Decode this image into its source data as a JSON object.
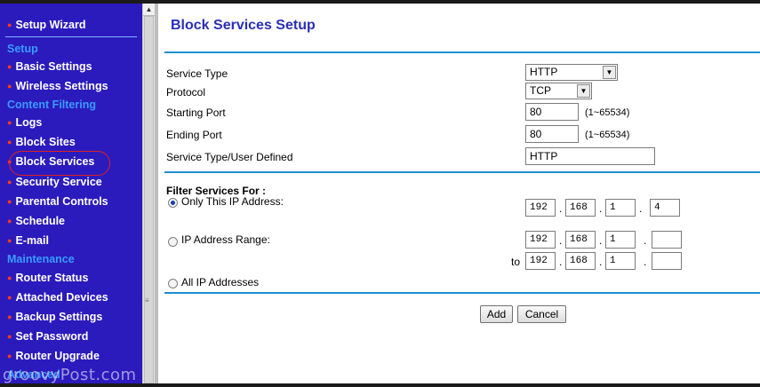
{
  "sidebar": {
    "items": [
      {
        "label": "Setup Wizard",
        "type": "item"
      },
      {
        "label": "Setup",
        "type": "header"
      },
      {
        "label": "Basic Settings",
        "type": "item"
      },
      {
        "label": "Wireless Settings",
        "type": "item"
      },
      {
        "label": "Content Filtering",
        "type": "header"
      },
      {
        "label": "Logs",
        "type": "item"
      },
      {
        "label": "Block Sites",
        "type": "item"
      },
      {
        "label": "Block Services",
        "type": "item",
        "highlighted": true
      },
      {
        "label": "Security Service",
        "type": "item"
      },
      {
        "label": "Parental Controls",
        "type": "item"
      },
      {
        "label": "Schedule",
        "type": "item"
      },
      {
        "label": "E-mail",
        "type": "item"
      },
      {
        "label": "Maintenance",
        "type": "header"
      },
      {
        "label": "Router Status",
        "type": "item"
      },
      {
        "label": "Attached Devices",
        "type": "item"
      },
      {
        "label": "Backup Settings",
        "type": "item"
      },
      {
        "label": "Set Password",
        "type": "item"
      },
      {
        "label": "Router Upgrade",
        "type": "item"
      },
      {
        "label": "Advanced",
        "type": "header"
      }
    ],
    "watermark": "groovyPost.com",
    "colors": {
      "background": "#2b1bbd",
      "header": "#3a9bff",
      "bullet": "#ff3b1a"
    }
  },
  "page": {
    "title": "Block Services Setup",
    "fields": {
      "service_type": {
        "label": "Service Type",
        "value": "HTTP"
      },
      "protocol": {
        "label": "Protocol",
        "value": "TCP"
      },
      "starting_port": {
        "label": "Starting Port",
        "value": "80",
        "range": "(1~65534)"
      },
      "ending_port": {
        "label": "Ending Port",
        "value": "80",
        "range": "(1~65534)"
      },
      "user_defined": {
        "label": "Service Type/User Defined",
        "value": "HTTP"
      }
    },
    "filter": {
      "heading": "Filter Services For :",
      "only_this_ip": {
        "label": "Only This IP Address:",
        "selected": true,
        "octets": [
          "192",
          "168",
          "1",
          "4"
        ]
      },
      "ip_range": {
        "label": "IP Address Range:",
        "selected": false,
        "from": [
          "192",
          "168",
          "1",
          ""
        ],
        "to_label": "to",
        "to": [
          "192",
          "168",
          "1",
          ""
        ]
      },
      "all_ip": {
        "label": "All IP Addresses",
        "selected": false
      }
    },
    "buttons": {
      "add": "Add",
      "cancel": "Cancel"
    },
    "colors": {
      "title": "#2a2fb5",
      "rule": "#1f8fd2"
    }
  }
}
